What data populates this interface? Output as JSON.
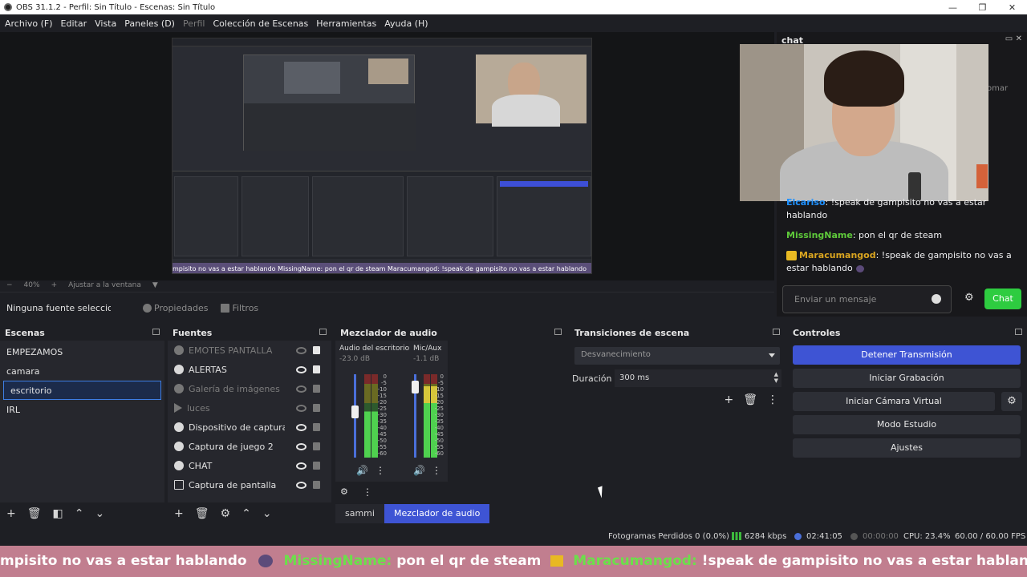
{
  "window": {
    "title": "OBS 31.1.2 - Perfil: Sin Título - Escenas: Sin Título",
    "minimize": "—",
    "maximize": "❐",
    "close": "✕"
  },
  "menu": [
    "Archivo (F)",
    "Editar",
    "Vista",
    "Paneles (D)",
    "Perfil",
    "Colección de Escenas",
    "Herramientas",
    "Ayuda (H)"
  ],
  "preview": {
    "ticker_text": "mpisito no vas a estar hablando  MissingName: pon el qr de steam  Maracumangod: !speak de gampisito no vas a estar hablando",
    "zoom": "40%",
    "fit_label": "Ajustar a la ventana"
  },
  "chat": {
    "title": "chat",
    "side_text": "omar",
    "messages": [
      {
        "user": "Elcariso",
        "user_color": "#1e90ff",
        "text": ": !speak de gampisito no vas a estar hablando"
      },
      {
        "user": "MissingName",
        "user_color": "#5ec93a",
        "text": ": pon el qr de steam"
      },
      {
        "user": "Maracumangod",
        "user_color": "#daa520",
        "text": ": !speak de gampisito no vas a estar hablando"
      }
    ],
    "input_placeholder": "Enviar un mensaje",
    "send_label": "Chat"
  },
  "source_bar": {
    "no_source": "Ninguna fuente seleccionada",
    "properties": "Propiedades",
    "filters": "Filtros"
  },
  "scenes": {
    "title": "Escenas",
    "items": [
      "EMPEZAMOS",
      "camara",
      "escritorio",
      "IRL"
    ],
    "selected": "escritorio"
  },
  "sources": {
    "title": "Fuentes",
    "items": [
      {
        "name": "EMOTES PANTALLA",
        "visible": false,
        "icon": "globe-icon"
      },
      {
        "name": "ALERTAS",
        "visible": true,
        "icon": "globe-icon"
      },
      {
        "name": "Galería de imágenes",
        "visible": false,
        "icon": "globe-icon"
      },
      {
        "name": "luces",
        "visible": false,
        "icon": "play-icon"
      },
      {
        "name": "Dispositivo de captura de vídeo",
        "visible": true,
        "icon": "camera-icon"
      },
      {
        "name": "Captura de juego 2",
        "visible": true,
        "icon": "gamepad-icon"
      },
      {
        "name": "CHAT",
        "visible": true,
        "icon": "globe-icon"
      },
      {
        "name": "Captura de pantalla",
        "visible": true,
        "icon": "monitor-icon"
      }
    ]
  },
  "mixer": {
    "title": "Mezclador de audio",
    "channels": [
      {
        "name": "Audio del escritorio",
        "db": "-23.0 dB",
        "level": 0.55
      },
      {
        "name": "Mic/Aux",
        "db": "-1.1 dB",
        "level": 0.85
      }
    ],
    "scale": [
      "0",
      "-5",
      "-10",
      "-15",
      "-20",
      "-25",
      "-30",
      "-35",
      "-40",
      "-45",
      "-50",
      "-55",
      "-60"
    ],
    "tabs": [
      "sammi",
      "Mezclador de audio"
    ],
    "active_tab": "Mezclador de audio"
  },
  "transitions": {
    "title": "Transiciones de escena",
    "selected": "Desvanecimiento",
    "duration_label": "Duración",
    "duration_value": "300 ms"
  },
  "controls": {
    "title": "Controles",
    "buttons": [
      "Detener Transmisión",
      "Iniciar Grabación",
      "Iniciar Cámara Virtual",
      "Modo Estudio",
      "Ajustes"
    ]
  },
  "status": {
    "dropped": "Fotogramas Perdidos 0 (0.0%)",
    "bitrate": "6284 kbps",
    "stream_time": "02:41:05",
    "rec_time": "00:00:00",
    "cpu": "CPU: 23.4%",
    "fps": "60.00 / 60.00 FPS"
  },
  "ticker": {
    "part1": "mpisito no vas a estar hablando",
    "user1": "MissingName:",
    "part2": "pon el qr de steam",
    "user2": "Maracumangod:",
    "part3": "!speak de gampisito no vas a estar hablando"
  },
  "colors": {
    "accent": "#3e54d4",
    "chat_button": "#2ecc40",
    "panel": "#26272d",
    "background": "#1e1f24"
  }
}
